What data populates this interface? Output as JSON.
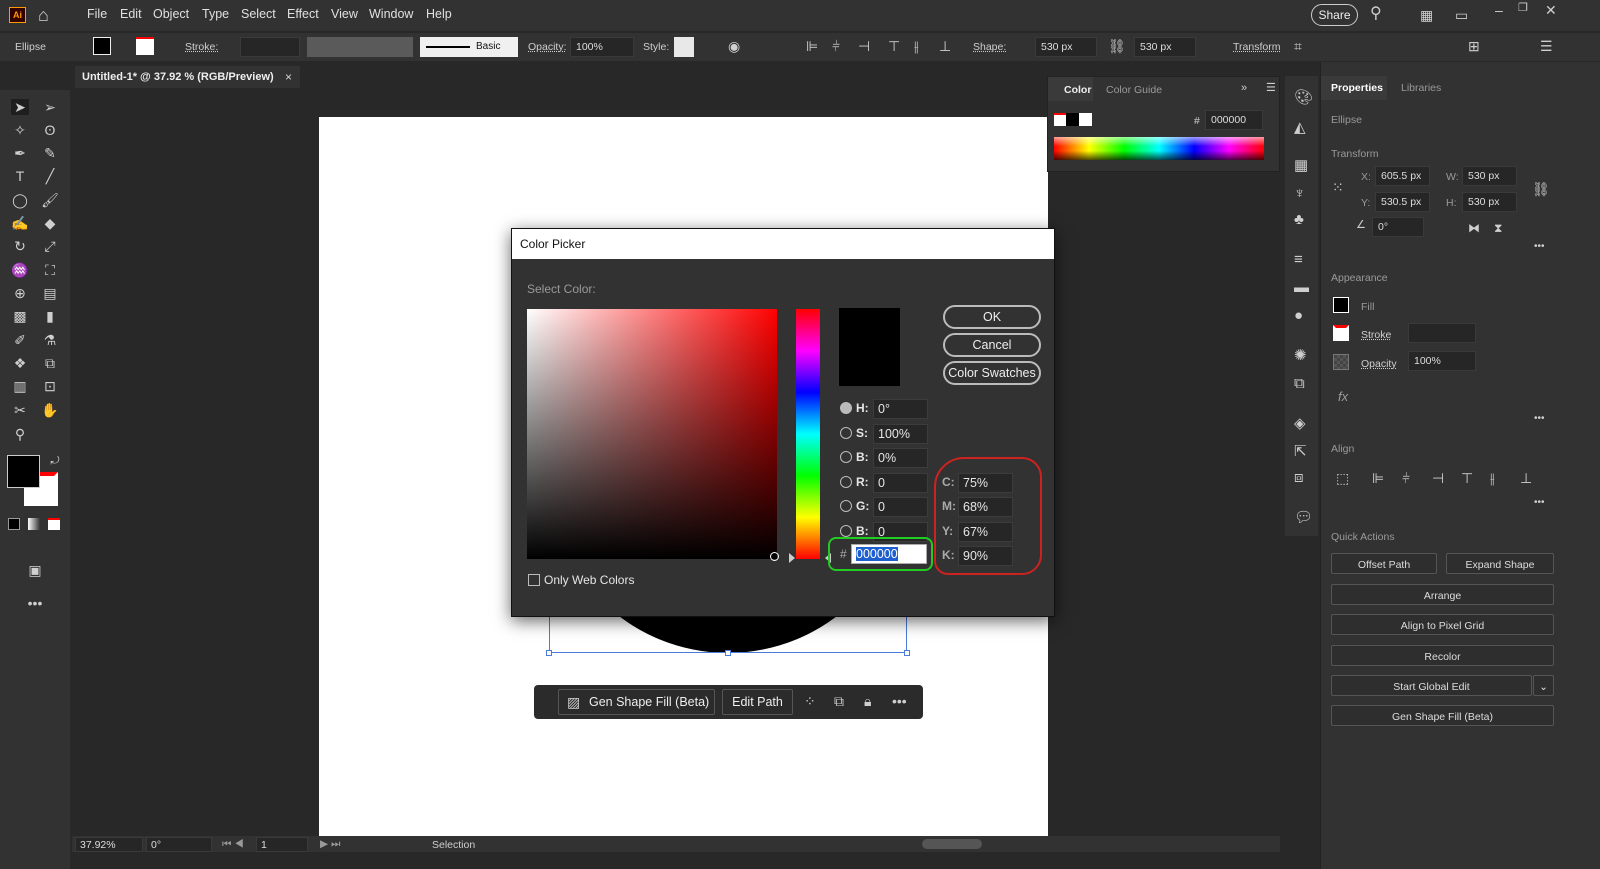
{
  "app": {
    "logo": "Ai",
    "menus": [
      "File",
      "Edit",
      "Object",
      "Type",
      "Select",
      "Effect",
      "View",
      "Window",
      "Help"
    ],
    "share": "Share"
  },
  "control": {
    "object": "Ellipse",
    "stroke_label": "Stroke:",
    "brush": "Basic",
    "opacity_label": "Opacity:",
    "opacity": "100%",
    "style_label": "Style:",
    "shape_label": "Shape:",
    "w": "530 px",
    "h": "530 px",
    "transform": "Transform"
  },
  "doc_tab": {
    "title": "Untitled-1* @ 37.92 % (RGB/Preview)",
    "close": "×"
  },
  "color_panel": {
    "tabs": [
      "Color",
      "Color Guide"
    ],
    "hex_label": "#",
    "hex": "000000"
  },
  "properties": {
    "tabs": [
      "Properties",
      "Libraries"
    ],
    "object": "Ellipse",
    "transform": "Transform",
    "x_label": "X:",
    "x": "605.5 px",
    "y_label": "Y:",
    "y": "530.5 px",
    "w_label": "W:",
    "w": "530 px",
    "h_label": "H:",
    "h": "530 px",
    "angle": "0°",
    "appearance": "Appearance",
    "fill": "Fill",
    "stroke": "Stroke",
    "opacity_label": "Opacity",
    "opacity": "100%",
    "fx": "fx",
    "align": "Align",
    "quick_actions": "Quick Actions",
    "actions": [
      "Offset Path",
      "Expand Shape",
      "Arrange",
      "Align to Pixel Grid",
      "Recolor",
      "Start Global Edit",
      "Gen Shape Fill (Beta)"
    ]
  },
  "picker": {
    "title": "Color Picker",
    "select_color": "Select Color:",
    "ok": "OK",
    "cancel": "Cancel",
    "swatches": "Color Swatches",
    "fields": [
      {
        "l": "H:",
        "v": "0°"
      },
      {
        "l": "S:",
        "v": "100%"
      },
      {
        "l": "B:",
        "v": "0%"
      },
      {
        "l": "R:",
        "v": "0"
      },
      {
        "l": "G:",
        "v": "0"
      },
      {
        "l": "B:",
        "v": "0"
      }
    ],
    "cmyk": [
      {
        "l": "C:",
        "v": "75%"
      },
      {
        "l": "M:",
        "v": "68%"
      },
      {
        "l": "Y:",
        "v": "67%"
      },
      {
        "l": "K:",
        "v": "90%"
      }
    ],
    "hex_label": "#",
    "hex": "000000",
    "web_only": "Only Web Colors",
    "selected_color": "#000000",
    "annotation_colors": {
      "hex": "#22cc22",
      "cmyk": "#cc2222"
    }
  },
  "context_bar": {
    "gen_fill": "Gen Shape Fill (Beta)",
    "edit_path": "Edit Path"
  },
  "status": {
    "zoom": "37.92%",
    "rotate": "0°",
    "page": "1",
    "mode": "Selection"
  }
}
